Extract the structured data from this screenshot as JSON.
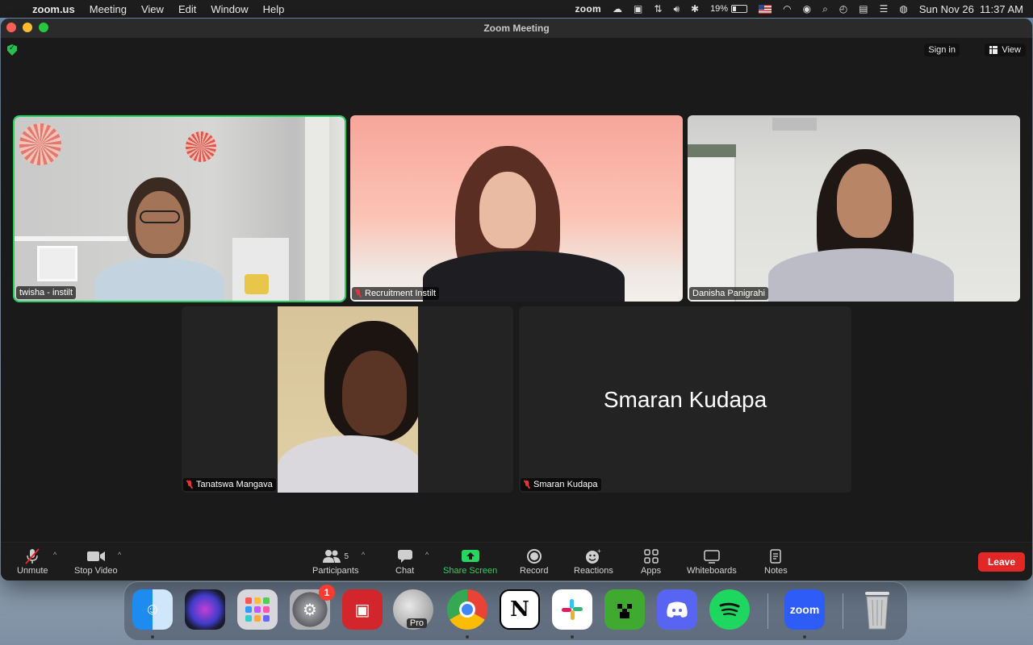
{
  "menubar": {
    "app_name": "zoom.us",
    "menus": [
      "Meeting",
      "View",
      "Edit",
      "Window",
      "Help"
    ],
    "zoom_status": "zoom",
    "battery_percent": "19%",
    "datetime": "Sun Nov 26  11:37 AM"
  },
  "window": {
    "title": "Zoom Meeting",
    "sign_in": "Sign in",
    "view": "View"
  },
  "participants": [
    {
      "name": "twisha - instilt",
      "muted": false,
      "active_speaker": true
    },
    {
      "name": "Recruitment Instilt",
      "muted": true,
      "active_speaker": false
    },
    {
      "name": "Danisha Panigrahi",
      "muted": false,
      "active_speaker": false
    },
    {
      "name": "Tanatswa Mangava",
      "muted": true,
      "active_speaker": false
    },
    {
      "name": "Smaran Kudapa",
      "muted": true,
      "active_speaker": false,
      "video_off_label": "Smaran Kudapa"
    }
  ],
  "toolbar": {
    "unmute": "Unmute",
    "stop_video": "Stop Video",
    "participants": "Participants",
    "participants_count": "5",
    "chat": "Chat",
    "share_screen": "Share Screen",
    "record": "Record",
    "reactions": "Reactions",
    "apps": "Apps",
    "whiteboards": "Whiteboards",
    "notes": "Notes",
    "leave": "Leave"
  },
  "dock": {
    "apps": [
      "Finder",
      "Siri",
      "Launchpad",
      "System Settings",
      "Photo Booth",
      "Google Earth Pro",
      "Google Chrome",
      "Notion",
      "Slack",
      "Minecraft",
      "Discord",
      "Spotify",
      "zoom.us",
      "Trash"
    ],
    "settings_badge": "1",
    "earth_label": "Pro",
    "zoom_label": "zoom"
  },
  "colors": {
    "active_speaker": "#23d160",
    "share_screen": "#27d65c",
    "leave": "#e22727"
  }
}
